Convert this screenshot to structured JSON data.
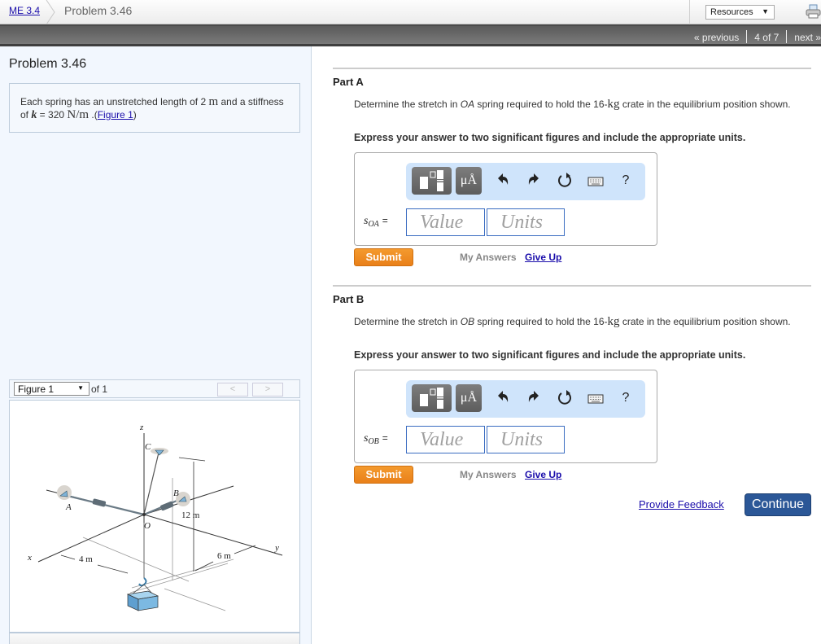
{
  "topbar": {
    "breadcrumb_link": "ME 3.4",
    "breadcrumb_current": "Problem 3.46",
    "resources_label": "Resources",
    "printer_icon": "printer-icon"
  },
  "nav": {
    "previous": "« previous",
    "position": "4 of 7",
    "next": "next »"
  },
  "problem": {
    "title": "Problem 3.46",
    "statement_pre": "Each spring has an unstretched length of 2 ",
    "unit_m": "m",
    "statement_mid": " and a stiffness of ",
    "k_symbol": "k",
    "statement_eq": " = 320 ",
    "unit_nm": "N/m",
    "statement_post": " .(",
    "figure_link": "Figure 1",
    "statement_close": ")"
  },
  "figure": {
    "selected": "Figure 1",
    "of_label": "of 1",
    "prev_label": "<",
    "next_label": ">",
    "labels": {
      "z": "z",
      "C": "C",
      "B": "B",
      "A": "A",
      "O": "O",
      "x": "x",
      "y": "y",
      "dim_12": "12 m",
      "dim_4": "4 m",
      "dim_6": "6 m"
    }
  },
  "parts": [
    {
      "title": "Part A",
      "question_pre": "Determine the stretch in ",
      "spring": "OA",
      "question_mid": " spring required to hold the 16-",
      "unit": "kg",
      "question_post": " crate in the equilibrium position shown.",
      "instruction": "Express your answer to two significant figures and include the appropriate units.",
      "variable": "s",
      "subscript": "OA",
      "equals": "=",
      "value_placeholder": "Value",
      "units_placeholder": "Units",
      "units_button": "μÅ",
      "help": "?",
      "submit": "Submit",
      "my_answers": "My Answers",
      "give_up": "Give Up"
    },
    {
      "title": "Part B",
      "question_pre": "Determine the stretch in ",
      "spring": "OB",
      "question_mid": " spring required to hold the 16-",
      "unit": "kg",
      "question_post": " crate in the equilibrium position shown.",
      "instruction": "Express your answer to two significant figures and include the appropriate units.",
      "variable": "s",
      "subscript": "OB",
      "equals": "=",
      "value_placeholder": "Value",
      "units_placeholder": "Units",
      "units_button": "μÅ",
      "help": "?",
      "submit": "Submit",
      "my_answers": "My Answers",
      "give_up": "Give Up"
    }
  ],
  "footer": {
    "feedback": "Provide Feedback",
    "continue": "Continue"
  },
  "colors": {
    "submit": "#ef8c22",
    "continue": "#2b5797",
    "link": "#1a0dab",
    "toolbar_bg": "#cfe4fb",
    "left_pane_bg": "#f2f7fe"
  }
}
